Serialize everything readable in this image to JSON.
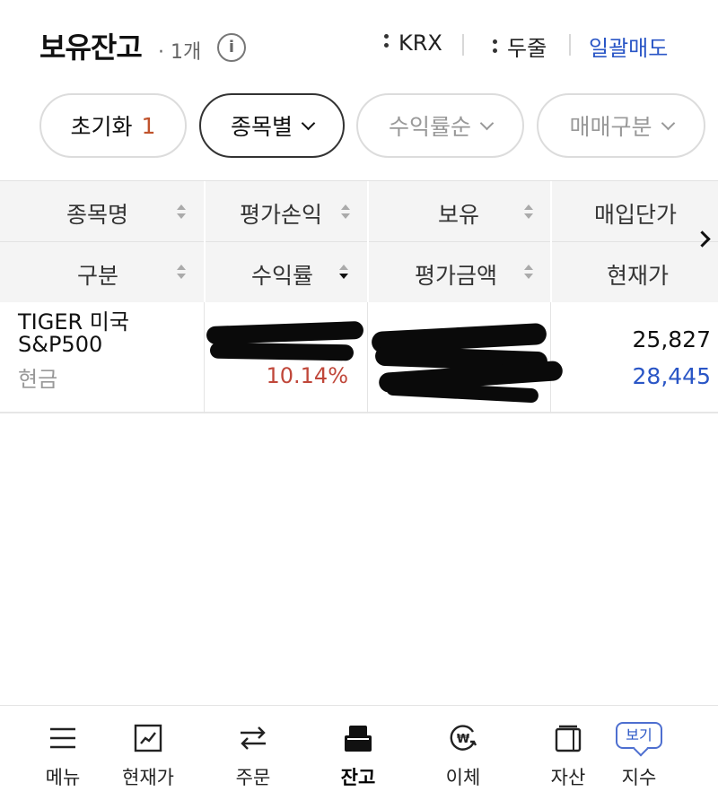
{
  "header": {
    "title": "보유잔고",
    "count": "· 1개",
    "info_glyph": "i",
    "options": [
      "KRX",
      "두줄"
    ],
    "bulk_sell": "일괄매도"
  },
  "filters": {
    "reset_label": "초기화",
    "reset_count": "1",
    "by_stock": "종목별",
    "by_return": "수익률순",
    "by_trade_type": "매매구분"
  },
  "table": {
    "header_row1": [
      "종목명",
      "평가손익",
      "보유",
      "매입단가"
    ],
    "header_row2": [
      "구분",
      "수익률",
      "평가금액",
      "현재가"
    ],
    "rows": [
      {
        "name_line1": "TIGER 미국",
        "name_line2": "S&P500",
        "type": "현금",
        "return_rate": "10.14%",
        "purchase_price": "25,827",
        "current_price": "28,445"
      }
    ]
  },
  "colors": {
    "accent_blue": "#2a56c6",
    "gain_red": "#c0473a",
    "reset_orange": "#c0532c"
  },
  "bottom_nav": [
    {
      "label": "메뉴",
      "icon": "menu-icon"
    },
    {
      "label": "현재가",
      "icon": "chart-icon"
    },
    {
      "label": "주문",
      "icon": "swap-arrows-icon"
    },
    {
      "label": "잔고",
      "icon": "wallet-balance-icon",
      "active": true
    },
    {
      "label": "이체",
      "icon": "transfer-won-icon"
    },
    {
      "label": "자산",
      "icon": "wallet-icon"
    },
    {
      "label": "지수",
      "icon": "index-icon",
      "badge": "보기"
    }
  ]
}
